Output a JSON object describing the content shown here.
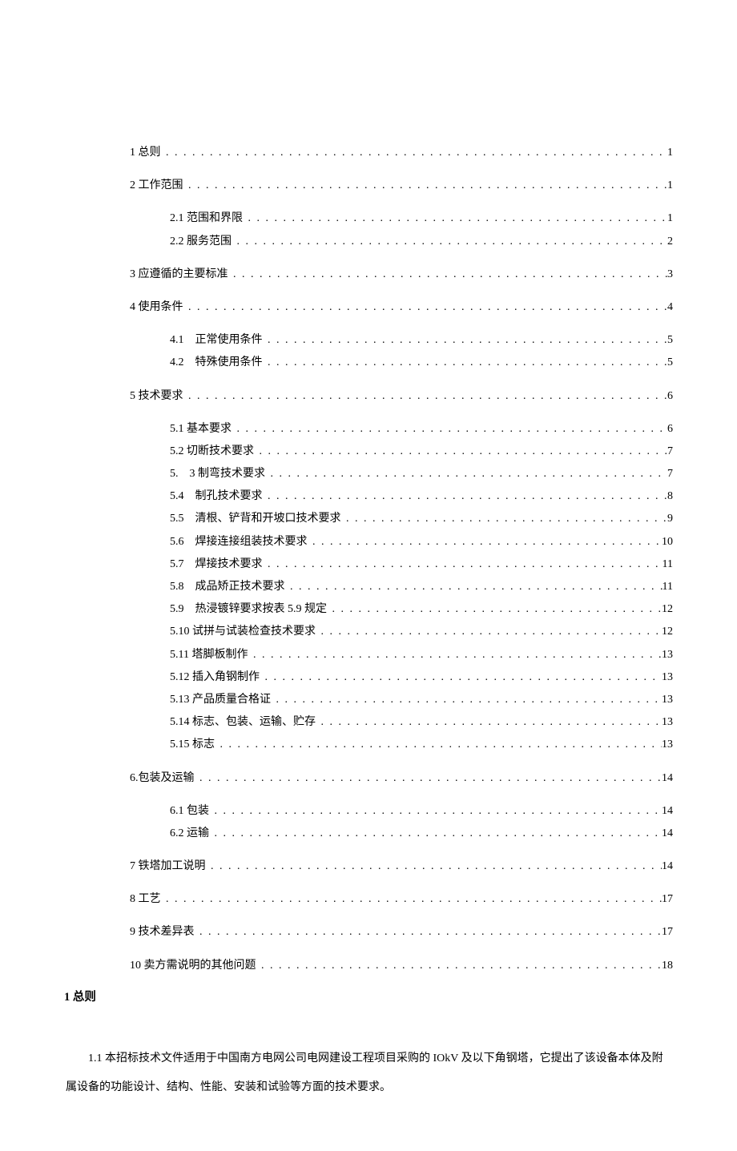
{
  "toc": [
    {
      "level": 1,
      "label": "1 总则",
      "page": "1"
    },
    {
      "level": 1,
      "label": "2 工作范围",
      "page": "1",
      "gapBefore": true
    },
    {
      "level": 2,
      "label": "2.1 范围和界限",
      "page": "1",
      "gapBefore": true
    },
    {
      "level": 2,
      "label": "2.2 服务范围",
      "page": "2"
    },
    {
      "level": 1,
      "label": "3 应遵循的主要标准",
      "page": "3",
      "gapBefore": true
    },
    {
      "level": 1,
      "label": "4 使用条件",
      "page": "4",
      "gapBefore": true
    },
    {
      "level": 2,
      "label": "4.1    正常使用条件",
      "page": "5",
      "gapBefore": true
    },
    {
      "level": 2,
      "label": "4.2    特殊使用条件",
      "page": "5"
    },
    {
      "level": 1,
      "label": "5 技术要求",
      "page": "6",
      "gapBefore": true
    },
    {
      "level": 2,
      "label": "5.1 基本要求",
      "page": "6",
      "gapBefore": true
    },
    {
      "level": 2,
      "label": "5.2 切断技术要求",
      "page": "7"
    },
    {
      "level": 2,
      "label": "5.    3 制弯技术要求",
      "page": "7"
    },
    {
      "level": 2,
      "label": "5.4    制孔技术要求",
      "page": "8"
    },
    {
      "level": 2,
      "label": "5.5    清根、铲背和开坡口技术要求",
      "page": "9"
    },
    {
      "level": 2,
      "label": "5.6    焊接连接组装技术要求",
      "page": "10"
    },
    {
      "level": 2,
      "label": "5.7    焊接技术要求",
      "page": "11"
    },
    {
      "level": 2,
      "label": "5.8    成品矫正技术要求",
      "page": "11"
    },
    {
      "level": 2,
      "label": "5.9    热浸镀锌要求按表 5.9 规定",
      "page": "12"
    },
    {
      "level": 2,
      "label": "5.10 试拼与试装检查技术要求",
      "page": "12"
    },
    {
      "level": 2,
      "label": "5.11 塔脚板制作",
      "page": "13"
    },
    {
      "level": 2,
      "label": "5.12 插入角钢制作",
      "page": "13"
    },
    {
      "level": 2,
      "label": "5.13 产品质量合格证",
      "page": "13"
    },
    {
      "level": 2,
      "label": "5.14 标志、包装、运输、贮存",
      "page": "13"
    },
    {
      "level": 2,
      "label": "5.15 标志",
      "page": "13"
    },
    {
      "level": 1,
      "label": "6.包装及运输",
      "page": "14",
      "gapBefore": true
    },
    {
      "level": 2,
      "label": "6.1 包装",
      "page": "14",
      "gapBefore": true
    },
    {
      "level": 2,
      "label": "6.2 运输",
      "page": "14"
    },
    {
      "level": 1,
      "label": "7 铁塔加工说明",
      "page": "14",
      "gapBefore": true
    },
    {
      "level": 1,
      "label": "8 工艺",
      "page": "17",
      "gapBefore": true
    },
    {
      "level": 1,
      "label": "9 技术差异表",
      "page": "17",
      "gapBefore": true
    },
    {
      "level": 1,
      "label": "10 卖方需说明的其他问题",
      "page": "18",
      "gapBefore": true
    }
  ],
  "heading1": "1 总则",
  "paragraph1": "1.1   本招标技术文件适用于中国南方电网公司电网建设工程项目采购的 IOkV 及以下角钢塔，它提出了该设备本体及附属设备的功能设计、结构、性能、安装和试验等方面的技术要求。"
}
